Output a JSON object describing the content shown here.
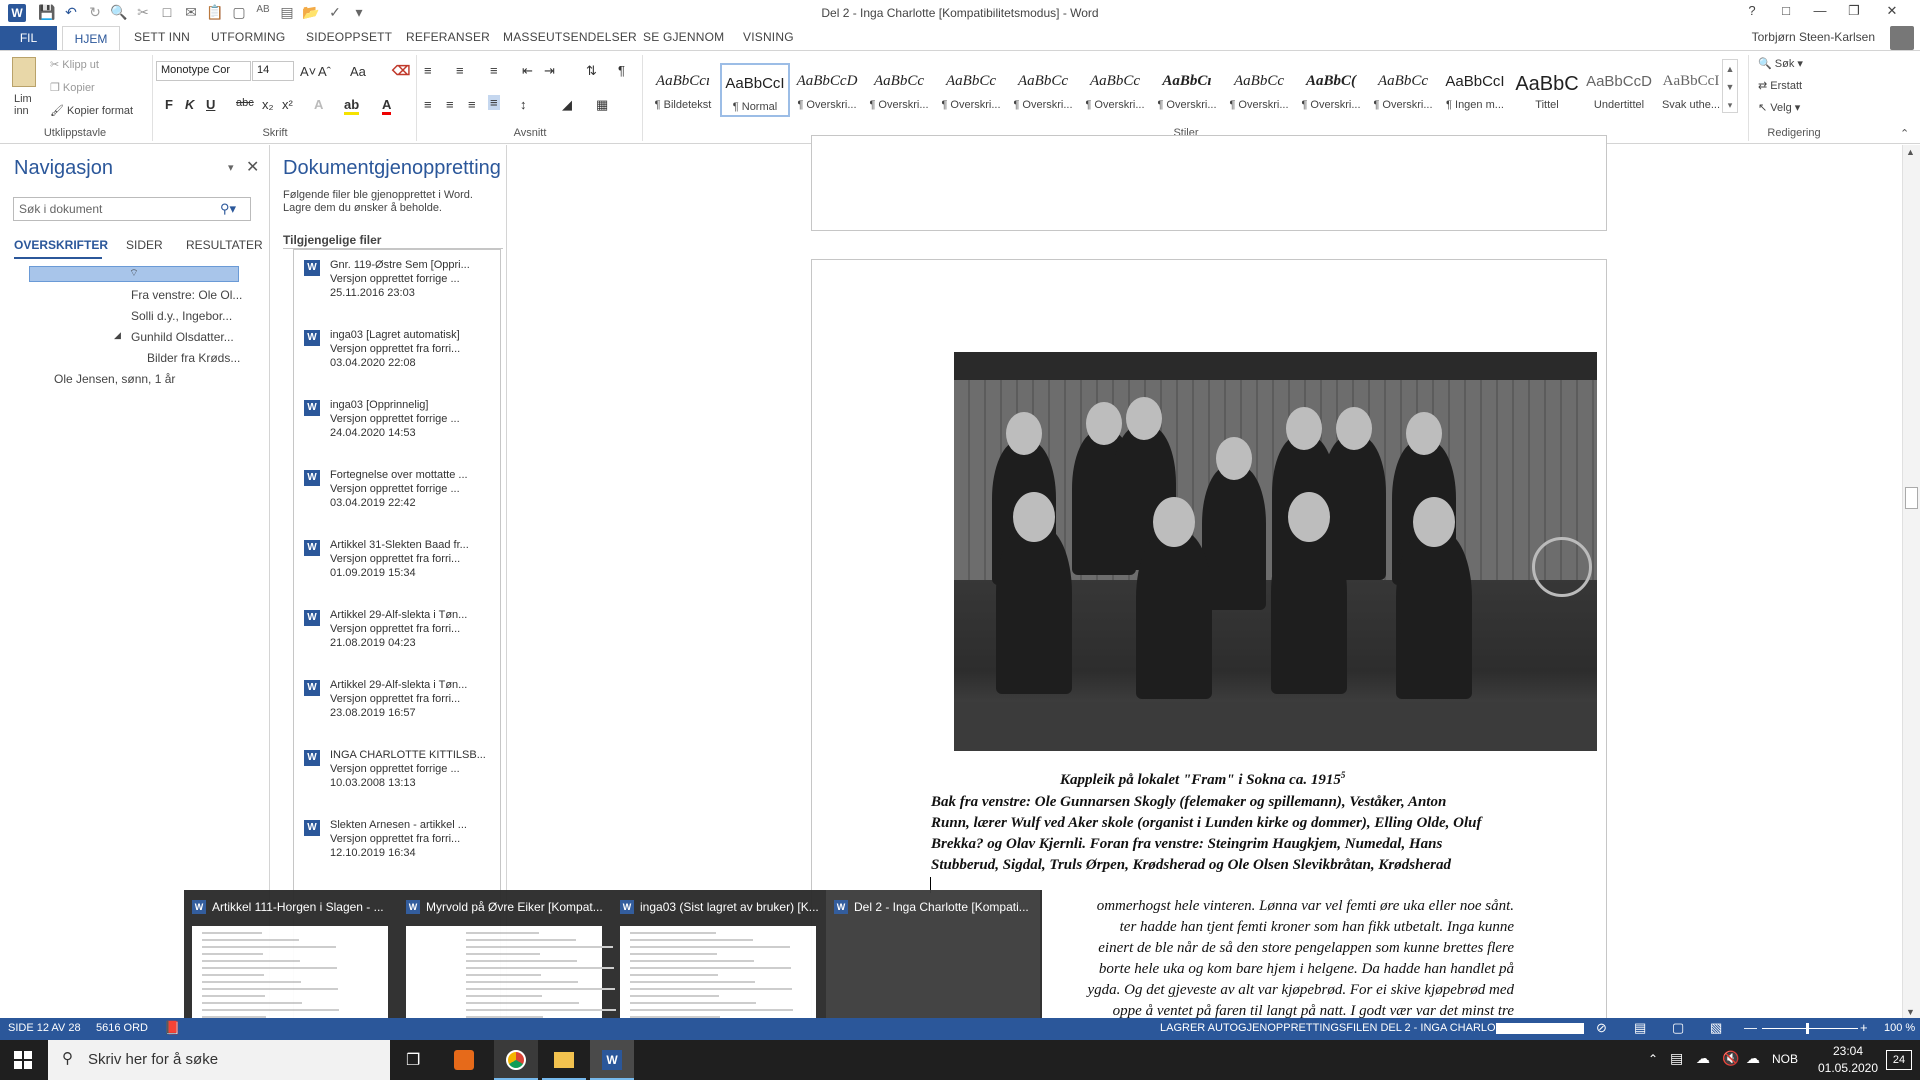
{
  "window": {
    "title": "Del 2 - Inga Charlotte [Kompatibilitetsmodus] - Word",
    "help": "?",
    "user": "Torbjørn Steen-Karlsen"
  },
  "tabs": [
    "FIL",
    "HJEM",
    "SETT INN",
    "UTFORMING",
    "SIDEOPPSETT",
    "REFERANSER",
    "MASSEUTSENDELSER",
    "SE GJENNOM",
    "VISNING"
  ],
  "ribbon": {
    "clipboard": {
      "paste": "Lim inn",
      "cut": "Klipp ut",
      "copy": "Kopier",
      "format_painter": "Kopier format",
      "label": "Utklippstavle"
    },
    "font": {
      "family": "Monotype Cor",
      "size": "14",
      "label": "Skrift",
      "bold": "F",
      "italic": "K",
      "underline": "U",
      "strike": "abc"
    },
    "paragraph": {
      "label": "Avsnitt"
    },
    "styles": {
      "label": "Stiler",
      "items": [
        {
          "preview": "AaBbCcı",
          "name": "¶ Bildetekst"
        },
        {
          "preview": "AaBbCcI",
          "name": "¶ Normal"
        },
        {
          "preview": "AaBbCcD",
          "name": "¶ Overskri..."
        },
        {
          "preview": "AaBbCc",
          "name": "¶ Overskri..."
        },
        {
          "preview": "AaBbCc",
          "name": "¶ Overskri..."
        },
        {
          "preview": "AaBbCc",
          "name": "¶ Overskri..."
        },
        {
          "preview": "AaBbCc",
          "name": "¶ Overskri..."
        },
        {
          "preview": "AaBbCı",
          "name": "¶ Overskri..."
        },
        {
          "preview": "AaBbCc",
          "name": "¶ Overskri..."
        },
        {
          "preview": "AaBbC(",
          "name": "¶ Overskri..."
        },
        {
          "preview": "AaBbCc",
          "name": "¶ Overskri..."
        },
        {
          "preview": "AaBbCcI",
          "name": "¶ Ingen m..."
        },
        {
          "preview": "AaBbC",
          "name": "Tittel"
        },
        {
          "preview": "AaBbCcD",
          "name": "Undertittel"
        },
        {
          "preview": "AaBbCcI",
          "name": "Svak uthe..."
        }
      ]
    },
    "editing": {
      "find": "Søk",
      "replace": "Erstatt",
      "select": "Velg",
      "label": "Redigering"
    }
  },
  "nav": {
    "title": "Navigasjon",
    "search_placeholder": "Søk i dokument",
    "tabs": [
      "OVERSKRIFTER",
      "SIDER",
      "RESULTATER"
    ],
    "items": [
      {
        "text": "Fra venstre: Ole Ol...",
        "level": 3
      },
      {
        "text": "Solli d.y., Ingebor...",
        "level": 3
      },
      {
        "text": "Gunhild Olsdatter...",
        "level": 3
      },
      {
        "text": "Bilder fra Krøds...",
        "level": 4
      },
      {
        "text": "Ole Jensen, sønn, 1 år",
        "level": 1
      }
    ]
  },
  "recovery": {
    "title": "Dokumentgjenoppretting",
    "description": "Følgende filer ble gjenopprettet i Word. Lagre dem du ønsker å beholde.",
    "list_label": "Tilgjengelige filer",
    "files": [
      {
        "name": "Gnr. 119-Østre Sem  [Oppri...",
        "status": "Versjon opprettet forrige ...",
        "date": "25.11.2016 23:03"
      },
      {
        "name": "inga03  [Lagret automatisk]",
        "status": "Versjon opprettet fra forri...",
        "date": "03.04.2020 22:08"
      },
      {
        "name": "inga03  [Opprinnelig]",
        "status": "Versjon opprettet forrige ...",
        "date": "24.04.2020 14:53"
      },
      {
        "name": "Fortegnelse over mottatte ...",
        "status": "Versjon opprettet forrige ...",
        "date": "03.04.2019 22:42"
      },
      {
        "name": "Artikkel 31-Slekten Baad fr...",
        "status": "Versjon opprettet fra forri...",
        "date": "01.09.2019 15:34"
      },
      {
        "name": "Artikkel 29-Alf-slekta i Tøn...",
        "status": "Versjon opprettet fra forri...",
        "date": "21.08.2019 04:23"
      },
      {
        "name": "Artikkel 29-Alf-slekta i Tøn...",
        "status": "Versjon opprettet fra forri...",
        "date": "23.08.2019 16:57"
      },
      {
        "name": "INGA CHARLOTTE KITTILSB...",
        "status": "Versjon opprettet forrige ...",
        "date": "10.03.2008 13:13"
      },
      {
        "name": "Slekten Arnesen - artikkel ...",
        "status": "Versjon opprettet fra forri...",
        "date": "12.10.2019 16:34"
      }
    ]
  },
  "document": {
    "caption_title": "Kappleik på lokalet \"Fram\" i Sokna ca. 1915",
    "caption_sup": "5",
    "caption_lines": [
      "Bak fra venstre: Ole Gunnarsen Skogly (felemaker og spillemann), Veståker, Anton",
      "Runn, lærer Wulf ved Aker skole (organist i Lunden kirke og dommer), Elling Olde, Oluf",
      "Brekka? og Olav Kjernli. Foran fra venstre: Steingrim Haugkjem, Numedal, Hans",
      "Stubberud, Sigdal, Truls Ørpen, Krødsherad og Ole Olsen Slevikbråtan, Krødsherad"
    ],
    "body_lines": [
      "ommerhogst hele vinteren. Lønna var vel femti øre uka eller noe sånt.",
      "ter hadde han tjent femti kroner som han fikk utbetalt. Inga kunne",
      "einert de ble når de så den store pengelappen som kunne brettes flere",
      "borte hele uka og kom bare hjem i helgene. Da hadde han handlet på",
      "ygda. Og det gjeveste av alt var kjøpebrød. For ei skive kjøpebrød med",
      "oppe å ventet på faren til langt på natt. I godt vær var det minst tre"
    ]
  },
  "thumbnails": [
    {
      "title": "Artikkel 111-Horgen i Slagen - ..."
    },
    {
      "title": "Myrvold på Øvre Eiker [Kompat..."
    },
    {
      "title": "inga03 (Sist lagret av bruker) [K..."
    },
    {
      "title": "Del 2 - Inga Charlotte [Kompati..."
    }
  ],
  "status": {
    "page": "SIDE 12 AV 28",
    "words": "5616 ORD",
    "autosave": "LAGRER AUTOGJENOPPRETTINGSFILEN DEL 2 - INGA CHARLOTTE:",
    "zoom": "100 %"
  },
  "taskbar": {
    "search_placeholder": "Skriv her for å søke",
    "lang": "NOB",
    "time": "23:04",
    "date": "01.05.2020",
    "notif": "24"
  },
  "colors": {
    "accent": "#2b579a",
    "taskbar": "#1f1f1f"
  }
}
